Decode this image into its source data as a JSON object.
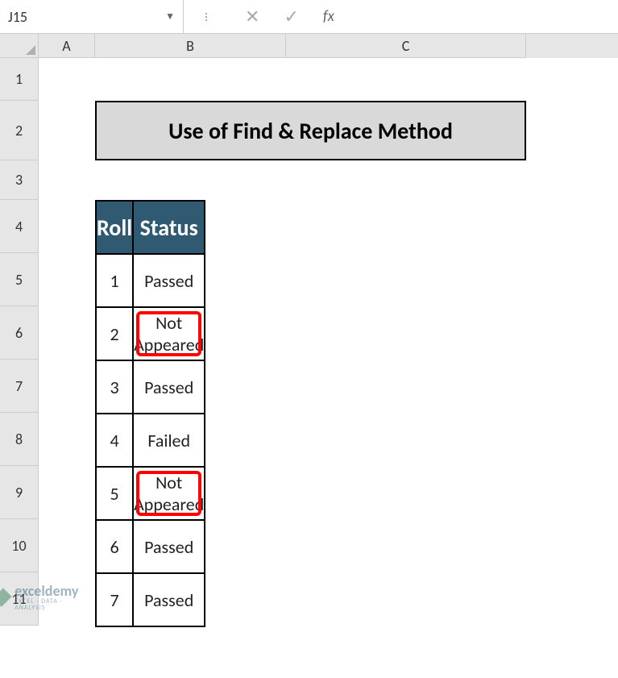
{
  "name_box": "J15",
  "fx_label": "fx",
  "columns": [
    "A",
    "B",
    "C"
  ],
  "rows": [
    "1",
    "2",
    "3",
    "4",
    "5",
    "6",
    "7",
    "8",
    "9",
    "10",
    "11"
  ],
  "title": "Use of Find & Replace Method",
  "table": {
    "headers": {
      "roll": "Roll",
      "status": "Status"
    },
    "data": [
      {
        "roll": "1",
        "status": "Passed",
        "highlight": false
      },
      {
        "roll": "2",
        "status": "Not Appeared",
        "highlight": true
      },
      {
        "roll": "3",
        "status": "Passed",
        "highlight": false
      },
      {
        "roll": "4",
        "status": "Failed",
        "highlight": false
      },
      {
        "roll": "5",
        "status": "Not Appeared",
        "highlight": true
      },
      {
        "roll": "6",
        "status": "Passed",
        "highlight": false
      },
      {
        "roll": "7",
        "status": "Passed",
        "highlight": false
      }
    ]
  },
  "watermark": {
    "main": "exceldemy",
    "sub": "EXCEL · DATA · ANALYSIS"
  }
}
